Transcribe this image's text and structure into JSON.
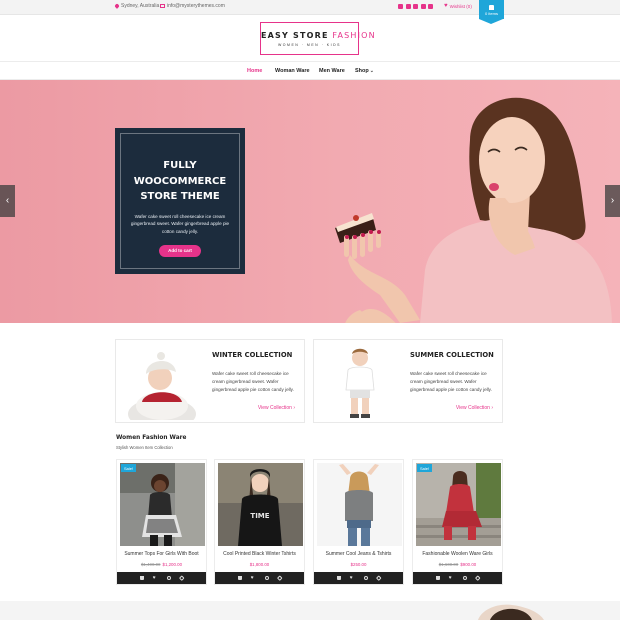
{
  "topbar": {
    "location": "Sydney, Australia",
    "email": "info@mysterythemes.com",
    "wishlist_label": "Wishlist (0)",
    "cart_label": "0 items",
    "social_icons": [
      "facebook-icon",
      "twitter-icon",
      "linkedin-icon",
      "instagram-icon",
      "youtube-icon"
    ]
  },
  "logo": {
    "title_part1": "EASY STORE",
    "title_part2": "FASHION",
    "tagline": "WOMEN · MEN · KIDS"
  },
  "nav": {
    "items": [
      "Home",
      "Woman Ware",
      "Men Ware",
      "Shop"
    ]
  },
  "hero": {
    "title": "FULLY WOOCOMMERCE STORE THEME",
    "text": "Wafer cake sweet roll cheesecake ice cream gingerbread sweet. Wafer gingerbread apple pie cotton candy jelly.",
    "button": "Add to cart",
    "prev": "‹",
    "next": "›"
  },
  "collections": [
    {
      "title": "WINTER COLLECTION",
      "text": "Wafer cake sweet roll cheesecake ice cream gingerbread sweet. Wafer gingerbread apple pie cotton candy jelly.",
      "link": "View Collection ›"
    },
    {
      "title": "SUMMER COLLECTION",
      "text": "Wafer cake sweet roll cheesecake ice cream gingerbread sweet. Wafer gingerbread apple pie cotton candy jelly.",
      "link": "View Collection ›"
    }
  ],
  "section": {
    "title": "Women Fashion Ware",
    "subtitle": "Stylish Women Item Collection"
  },
  "products": [
    {
      "name": "Summer Tops For Girls With Boot",
      "old_price": "$1,400.00",
      "price": "$1,200.00",
      "badge": "Sale!"
    },
    {
      "name": "Cool Printed Black Winter Tshirts",
      "old_price": "",
      "price": "$1,800.00",
      "badge": ""
    },
    {
      "name": "Summer Cool Jeans & Tshirts",
      "old_price": "",
      "price": "$250.00",
      "badge": ""
    },
    {
      "name": "Fashionable Woolen Ware Girls",
      "old_price": "$1,600.00",
      "price": "$900.00",
      "badge": "Sale!"
    }
  ],
  "colors": {
    "accent": "#e6338a",
    "badge": "#1fa6d9",
    "hero_bg": "#f2aab1",
    "hero_box": "#1c2c3d"
  }
}
